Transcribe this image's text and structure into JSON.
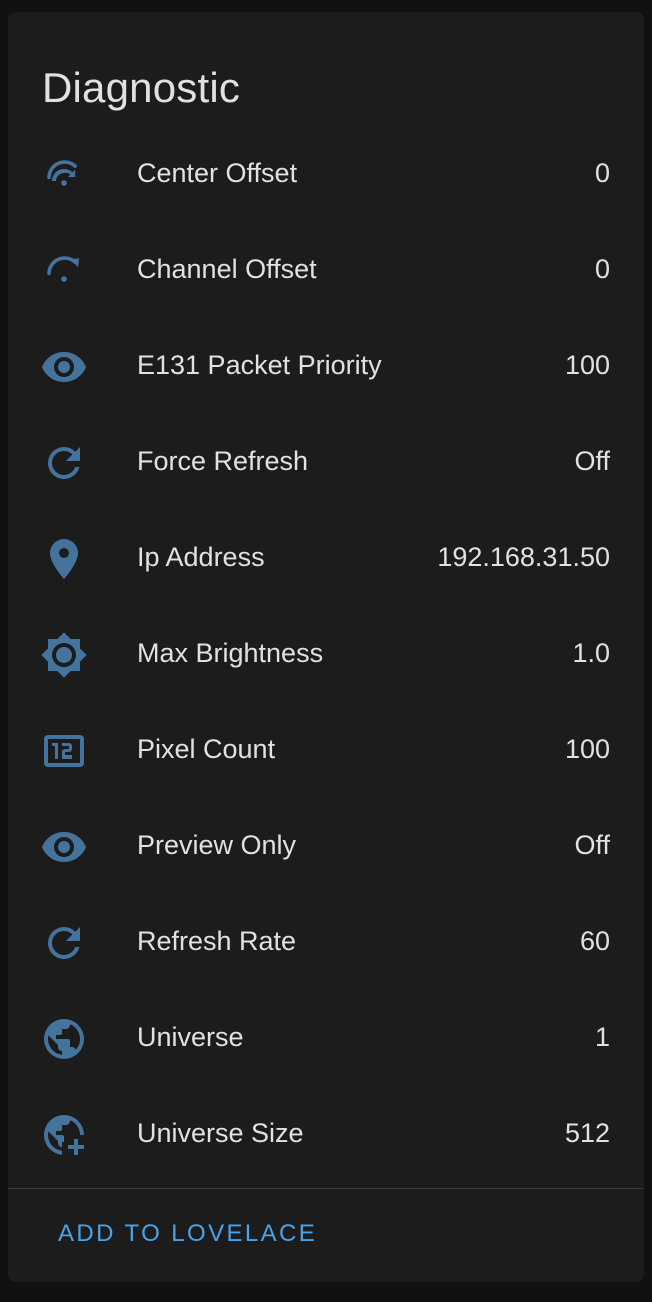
{
  "card": {
    "title": "Diagnostic",
    "action_label": "ADD TO LOVELACE"
  },
  "colors": {
    "icon": "#44739e",
    "text": "#e1e1e1",
    "accent": "#4aa3e8",
    "card_bg": "#1c1c1c",
    "page_bg": "#111111"
  },
  "rows": [
    {
      "icon": "gauge-icon",
      "label": "Center Offset",
      "value": "0"
    },
    {
      "icon": "gauge-icon",
      "label": "Channel Offset",
      "value": "0"
    },
    {
      "icon": "eye-icon",
      "label": "E131 Packet Priority",
      "value": "100"
    },
    {
      "icon": "refresh-icon",
      "label": "Force Refresh",
      "value": "Off"
    },
    {
      "icon": "map-marker-icon",
      "label": "Ip Address",
      "value": "192.168.31.50"
    },
    {
      "icon": "brightness-icon",
      "label": "Max Brightness",
      "value": "1.0"
    },
    {
      "icon": "numeric-icon",
      "label": "Pixel Count",
      "value": "100"
    },
    {
      "icon": "eye-icon",
      "label": "Preview Only",
      "value": "Off"
    },
    {
      "icon": "refresh-icon",
      "label": "Refresh Rate",
      "value": "60"
    },
    {
      "icon": "earth-icon",
      "label": "Universe",
      "value": "1"
    },
    {
      "icon": "earth-plus-icon",
      "label": "Universe Size",
      "value": "512"
    }
  ]
}
